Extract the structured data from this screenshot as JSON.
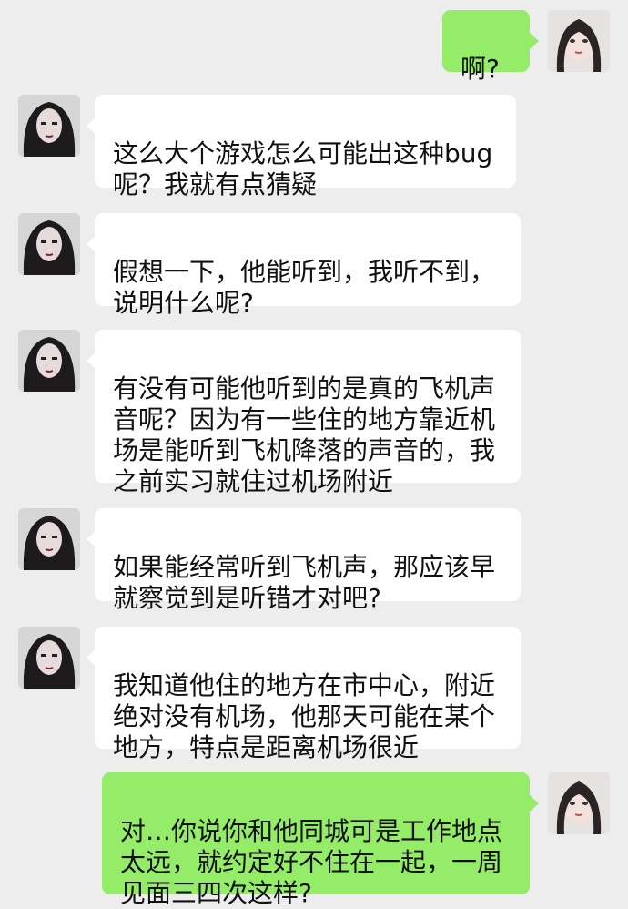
{
  "chat": {
    "messages": [
      {
        "side": "right",
        "text": "啊?"
      },
      {
        "side": "left",
        "text": "这么大个游戏怎么可能出这种bug\n呢？我就有点猜疑"
      },
      {
        "side": "left",
        "text": "假想一下，他能听到，我听不到，\n说明什么呢?"
      },
      {
        "side": "left",
        "text": "有没有可能他听到的是真的飞机声\n音呢？因为有一些住的地方靠近机\n场是能听到飞机降落的声音的，我\n之前实习就住过机场附近"
      },
      {
        "side": "left",
        "text": "如果能经常听到飞机声，那应该早\n就察觉到是听错才对吧?"
      },
      {
        "side": "left",
        "text": "我知道他住的地方在市中心，附近\n绝对没有机场，他那天可能在某个\n地方，特点是距离机场很近"
      },
      {
        "side": "right",
        "text": "对…你说你和他同城可是工作地点\n太远，就约定好不住在一起，一周\n见面三四次这样?"
      }
    ]
  },
  "colors": {
    "background": "#ededed",
    "incoming_bubble": "#ffffff",
    "outgoing_bubble": "#95ec69"
  }
}
